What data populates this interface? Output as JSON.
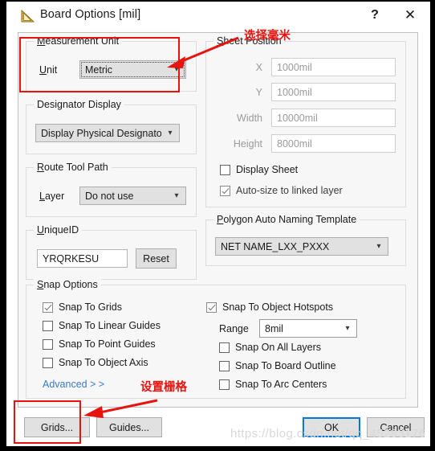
{
  "window": {
    "title": "Board Options [mil]",
    "icon": "ruler-triangle-icon",
    "help_label": "?",
    "close_label": "✕"
  },
  "measurement_unit": {
    "group_label": "Measurement Unit",
    "unit_label": "Unit",
    "unit_value": "Metric"
  },
  "designator_display": {
    "group_label": "Designator Display",
    "value": "Display Physical Designators"
  },
  "route_tool_path": {
    "group_label": "Route Tool Path",
    "layer_label": "Layer",
    "layer_value": "Do not use"
  },
  "unique_id": {
    "group_label": "UniqueID",
    "value": "YRQRKESU",
    "reset_label": "Reset"
  },
  "sheet_position": {
    "group_label": "Sheet Position",
    "fields": [
      {
        "label": "X",
        "value": "1000mil"
      },
      {
        "label": "Y",
        "value": "1000mil"
      },
      {
        "label": "Width",
        "value": "10000mil"
      },
      {
        "label": "Height",
        "value": "8000mil"
      }
    ],
    "display_sheet_label": "Display Sheet",
    "display_sheet_checked": false,
    "autosize_label": "Auto-size to linked layer",
    "autosize_checked": true
  },
  "polygon_naming": {
    "group_label": "Polygon Auto Naming Template",
    "value": "NET NAME_LXX_PXXX"
  },
  "snap_options": {
    "group_label": "Snap Options",
    "left_items": [
      {
        "label": "Snap To Grids",
        "checked": true
      },
      {
        "label": "Snap To Linear Guides",
        "checked": false
      },
      {
        "label": "Snap To Point Guides",
        "checked": false
      },
      {
        "label": "Snap To Object Axis",
        "checked": false
      }
    ],
    "advanced_label": "Advanced > >",
    "hotspots_label": "Snap To Object Hotspots",
    "hotspots_checked": true,
    "range_label": "Range",
    "range_value": "8mil",
    "right_items": [
      {
        "label": "Snap On All Layers",
        "checked": false
      },
      {
        "label": "Snap To Board Outline",
        "checked": false
      },
      {
        "label": "Snap To Arc Centers",
        "checked": false
      }
    ]
  },
  "buttons": {
    "grids": "Grids...",
    "guides": "Guides...",
    "ok": "OK",
    "cancel": "Cancel"
  },
  "annotations": {
    "select_mm": "选择毫米",
    "set_grid": "设置栅格",
    "accent_color": "#e8130f"
  },
  "watermark": {
    "text": "https://blog.csdn.net/qq_45283176"
  }
}
